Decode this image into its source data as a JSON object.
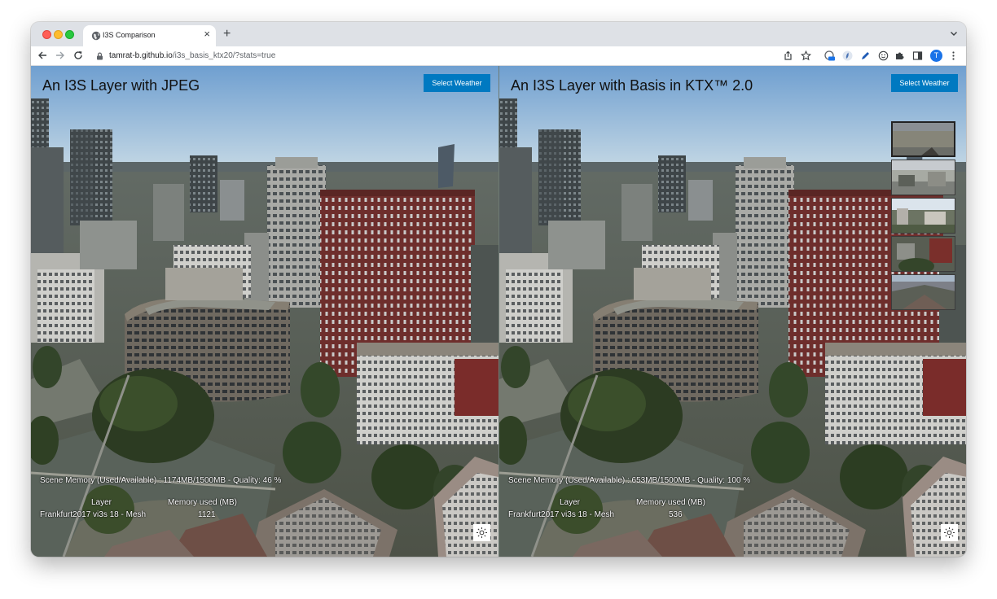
{
  "browser": {
    "tab_title": "I3S Comparison",
    "tab_close": "×",
    "new_tab": "+",
    "url_host": "tamrat-b.github.io",
    "url_path": "/i3s_basis_ktx20/?stats=true",
    "profile_initial": "T",
    "extension_badge": "off"
  },
  "left_view": {
    "title": "An I3S Layer with JPEG",
    "weather_button": "Select Weather",
    "stats_summary": "Scene Memory (Used/Available) : 1174MB/1500MB - Quality: 46 %",
    "stats_header_layer": "Layer",
    "stats_header_memory": "Memory used (MB)",
    "stats_row_layer": "Frankfurt2017 vi3s 18 - Mesh",
    "stats_row_memory": "1121"
  },
  "right_view": {
    "title": "An I3S Layer with Basis in KTX™ 2.0",
    "weather_button": "Select Weather",
    "stats_summary": "Scene Memory (Used/Available) : 653MB/1500MB - Quality: 100 %",
    "stats_header_layer": "Layer",
    "stats_header_memory": "Memory used (MB)",
    "stats_row_layer": "Frankfurt2017 vi3s 18 - Mesh",
    "stats_row_memory": "536",
    "weather_options": [
      "sunny",
      "cloudy",
      "rainy",
      "snowy",
      "foggy"
    ]
  },
  "colors": {
    "button_blue": "#0079c1",
    "sky_top": "#6f9fd0",
    "sky_bottom": "#c4d8e6",
    "brick": "#6e2e2c"
  }
}
